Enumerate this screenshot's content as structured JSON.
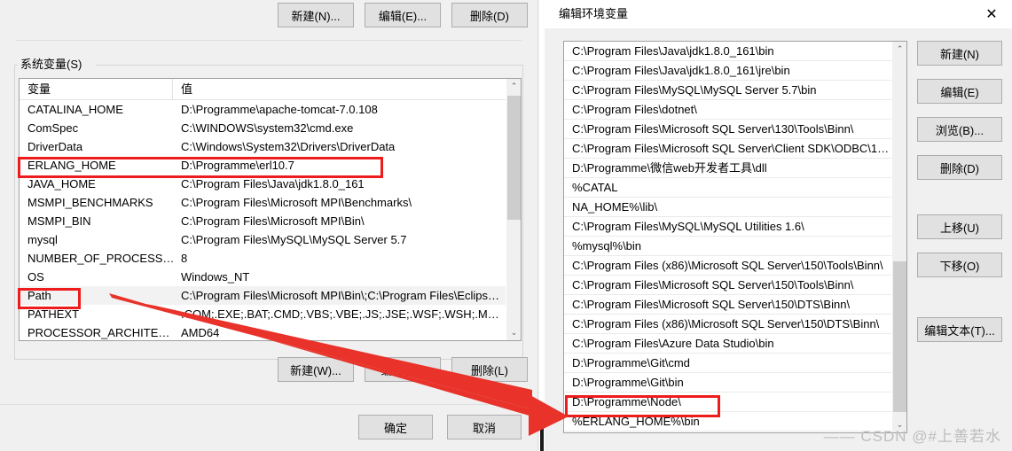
{
  "env_dialog": {
    "user_buttons": [
      {
        "label": "新建(N)..."
      },
      {
        "label": "编辑(E)..."
      },
      {
        "label": "删除(D)"
      }
    ],
    "system_group_label": "系统变量(S)",
    "columns": [
      "变量",
      "值"
    ],
    "rows": [
      {
        "name": "CATALINA_HOME",
        "value": "D:\\Programme\\apache-tomcat-7.0.108",
        "selected": false,
        "highlight": false
      },
      {
        "name": "ComSpec",
        "value": "C:\\WINDOWS\\system32\\cmd.exe",
        "selected": false,
        "highlight": false
      },
      {
        "name": "DriverData",
        "value": "C:\\Windows\\System32\\Drivers\\DriverData",
        "selected": false,
        "highlight": false
      },
      {
        "name": "ERLANG_HOME",
        "value": "D:\\Programme\\erl10.7",
        "selected": false,
        "highlight": true
      },
      {
        "name": "JAVA_HOME",
        "value": "C:\\Program Files\\Java\\jdk1.8.0_161",
        "selected": false,
        "highlight": false
      },
      {
        "name": "MSMPI_BENCHMARKS",
        "value": "C:\\Program Files\\Microsoft MPI\\Benchmarks\\",
        "selected": false,
        "highlight": false
      },
      {
        "name": "MSMPI_BIN",
        "value": "C:\\Program Files\\Microsoft MPI\\Bin\\",
        "selected": false,
        "highlight": false
      },
      {
        "name": "mysql",
        "value": "C:\\Program Files\\MySQL\\MySQL Server 5.7",
        "selected": false,
        "highlight": false
      },
      {
        "name": "NUMBER_OF_PROCESSORS",
        "value": "8",
        "selected": false,
        "highlight": false
      },
      {
        "name": "OS",
        "value": "Windows_NT",
        "selected": false,
        "highlight": false
      },
      {
        "name": "Path",
        "value": "C:\\Program Files\\Microsoft MPI\\Bin\\;C:\\Program Files\\Eclipse...",
        "selected": true,
        "highlight": true
      },
      {
        "name": "PATHEXT",
        "value": ".COM;.EXE;.BAT;.CMD;.VBS;.VBE;.JS;.JSE;.WSF;.WSH;.MSC",
        "selected": false,
        "highlight": false
      },
      {
        "name": "PROCESSOR_ARCHITECT...",
        "value": "AMD64",
        "selected": false,
        "highlight": false
      }
    ],
    "system_buttons": [
      {
        "label": "新建(W)..."
      },
      {
        "label": "编辑(I)..."
      },
      {
        "label": "删除(L)"
      }
    ],
    "footer_buttons": [
      {
        "label": "确定"
      },
      {
        "label": "取消"
      }
    ],
    "scroll_up_glyph": "⌃",
    "scroll_down_glyph": "⌄"
  },
  "edit_window": {
    "title": "编辑环境变量",
    "close_glyph": "✕",
    "path_entries": [
      "C:\\Program Files\\Java\\jdk1.8.0_161\\bin",
      "C:\\Program Files\\Java\\jdk1.8.0_161\\jre\\bin",
      "C:\\Program Files\\MySQL\\MySQL Server 5.7\\bin",
      "C:\\Program Files\\dotnet\\",
      "C:\\Program Files\\Microsoft SQL Server\\130\\Tools\\Binn\\",
      "C:\\Program Files\\Microsoft SQL Server\\Client SDK\\ODBC\\17...",
      "D:\\Programme\\微信web开发者工具\\dll",
      "%CATAL",
      "NA_HOME%\\lib\\",
      "C:\\Program Files\\MySQL\\MySQL Utilities 1.6\\",
      "%mysql%\\bin",
      "C:\\Program Files (x86)\\Microsoft SQL Server\\150\\Tools\\Binn\\",
      "C:\\Program Files\\Microsoft SQL Server\\150\\Tools\\Binn\\",
      "C:\\Program Files\\Microsoft SQL Server\\150\\DTS\\Binn\\",
      "C:\\Program Files (x86)\\Microsoft SQL Server\\150\\DTS\\Binn\\",
      "C:\\Program Files\\Azure Data Studio\\bin",
      "D:\\Programme\\Git\\cmd",
      "D:\\Programme\\Git\\bin",
      "D:\\Programme\\Node\\",
      "%ERLANG_HOME%\\bin",
      ""
    ],
    "highlighted_entry_index": 19,
    "buttons": [
      {
        "label": "新建(N)"
      },
      {
        "label": "编辑(E)"
      },
      {
        "label": "浏览(B)..."
      },
      {
        "label": "删除(D)"
      },
      {
        "label": "上移(U)"
      },
      {
        "label": "下移(O)"
      },
      {
        "label": "编辑文本(T)..."
      }
    ],
    "scroll_up_glyph": "⌃",
    "scroll_down_glyph": "⌄"
  },
  "annotations": {
    "highlight_color": "#ee1c1c",
    "arrow_color": "#e8322a",
    "watermark": "—— CSDN @#上善若水"
  }
}
